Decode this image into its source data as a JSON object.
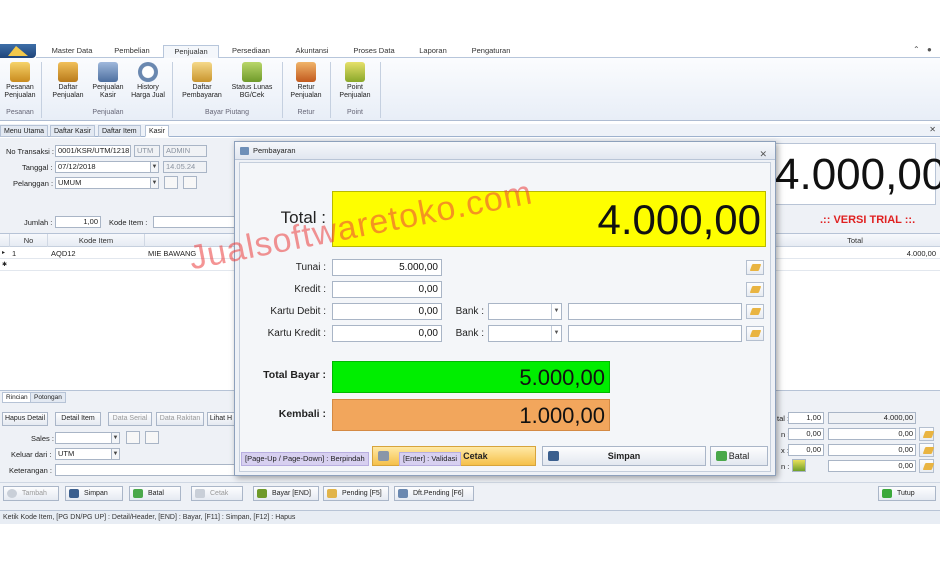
{
  "menu": {
    "tabs": [
      "Master Data",
      "Pembelian",
      "Penjualan",
      "Persediaan",
      "Akuntansi",
      "Proses Data",
      "Laporan",
      "Pengaturan"
    ],
    "active_tab": "Penjualan"
  },
  "ribbon": {
    "buttons": [
      {
        "label1": "Pesanan",
        "label2": "Penjualan"
      },
      {
        "label1": "Daftar",
        "label2": "Penjualan"
      },
      {
        "label1": "Penjualan",
        "label2": "Kasir"
      },
      {
        "label1": "History",
        "label2": "Harga Jual"
      },
      {
        "label1": "Daftar",
        "label2": "Pembayaran"
      },
      {
        "label1": "Status Lunas",
        "label2": "BG/Cek"
      },
      {
        "label1": "Retur",
        "label2": "Penjualan"
      },
      {
        "label1": "Point",
        "label2": "Penjualan"
      }
    ],
    "groups": [
      "Pesanan",
      "Penjualan",
      "Bayar Piutang",
      "Retur",
      "Point"
    ]
  },
  "doc_tabs": [
    "Menu Utama",
    "Daftar Kasir",
    "Daftar Item",
    "Kasir"
  ],
  "form": {
    "no_transaksi_label": "No Transaksi :",
    "no_transaksi": "0001/KSR/UTM/1218",
    "utm": "UTM",
    "admin": "ADMIN",
    "tanggal_label": "Tanggal :",
    "tanggal": "07/12/2018",
    "jam": "14.05.24",
    "pelanggan_label": "Pelanggan :",
    "pelanggan": "UMUM",
    "jumlah_label": "Jumlah :",
    "jumlah": "1,00",
    "kode_item_label": "Kode Item :",
    "big_total": "4.000,00",
    "trial": ".:: VERSI TRIAL ::."
  },
  "grid": {
    "headers": [
      "No",
      "Kode Item",
      "Total"
    ],
    "rows": [
      {
        "no": "1",
        "kode": "AQD12",
        "nama": "MIE BAWANG",
        "total": "4.000,00"
      }
    ]
  },
  "bottom": {
    "sub_tabs": [
      "Rincian",
      "Potongan"
    ],
    "buttons": [
      "Hapus Detail",
      "Detail Item",
      "Data Serial",
      "Data Rakitan",
      "Lihat H"
    ],
    "sales_label": "Sales :",
    "keluar_label": "Keluar dari :",
    "keluar": "UTM",
    "keterangan_label": "Keterangan :",
    "right_labels": [
      "tal :",
      "n :",
      "x :",
      "n :"
    ],
    "right_qty": "1,00",
    "right_values": [
      "4.000,00",
      "0,00",
      "0,00",
      "0,00"
    ],
    "right_small": [
      "0,00",
      "0,00"
    ]
  },
  "actions": [
    "Tambah",
    "Simpan",
    "Batal",
    "Cetak",
    "Bayar [END]",
    "Pending [F5]",
    "Dft.Pending [F6]",
    "Tutup"
  ],
  "status": "Ketik Kode Item, [PG DN/PG UP] : Detail/Header, [END] : Bayar, [F11] : Simpan, [F12] : Hapus",
  "dialog": {
    "title": "Pembayaran",
    "total_label": "Total :",
    "total": "4.000,00",
    "tunai_label": "Tunai :",
    "tunai": "5.000,00",
    "kredit_label": "Kredit :",
    "kredit": "0,00",
    "kartu_debit_label": "Kartu Debit :",
    "kartu_debit": "0,00",
    "kartu_kredit_label": "Kartu Kredit :",
    "kartu_kredit": "0,00",
    "bank_label": "Bank :",
    "total_bayar_label": "Total Bayar :",
    "total_bayar": "5.000,00",
    "kembali_label": "Kembali :",
    "kembali": "1.000,00",
    "btn_simpan_cetak": "Simpan + Cetak",
    "btn_simpan": "Simpan",
    "btn_batal": "Batal",
    "hint1": "[Page-Up / Page-Down] : Berpindah",
    "hint2": "[Enter] : Validasi"
  },
  "watermark": "Jualsoftwaretoko.com"
}
